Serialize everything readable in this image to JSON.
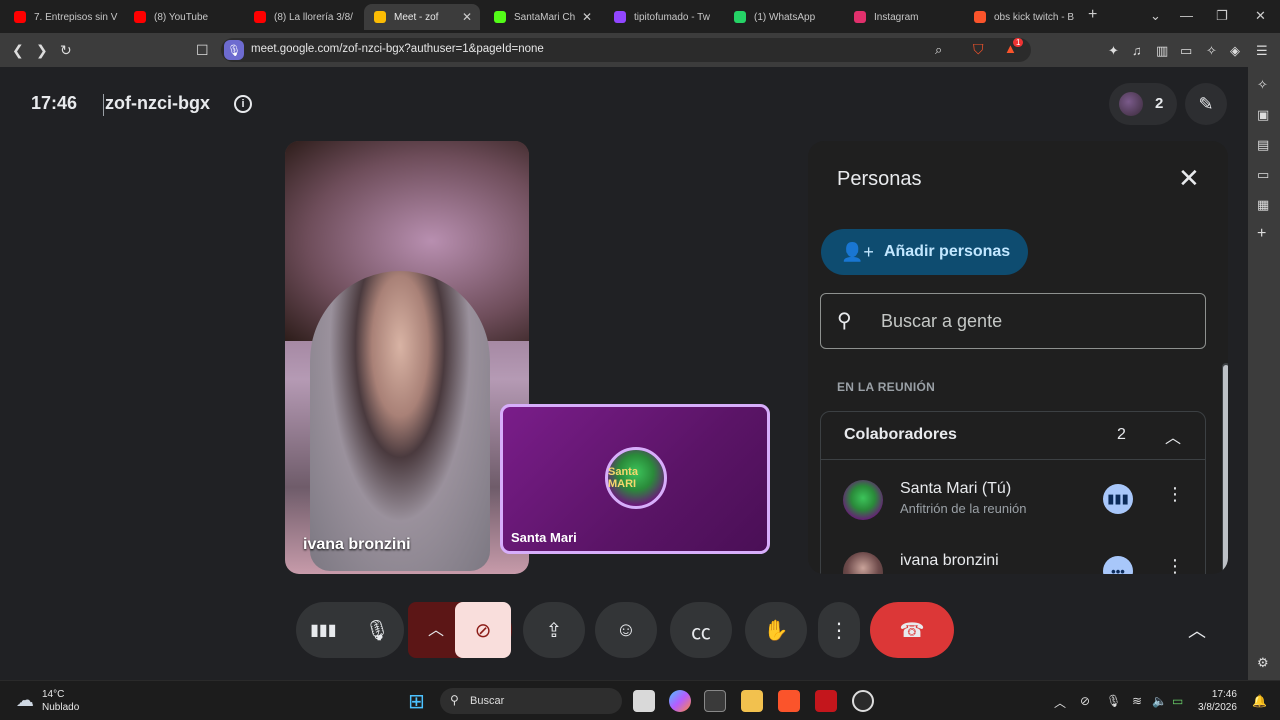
{
  "browser": {
    "tabs": [
      {
        "title": "7. Entrepisos sin V",
        "color": "#ff0000"
      },
      {
        "title": "(8) YouTube",
        "color": "#ff0000"
      },
      {
        "title": "(8) La llorería 3/8/",
        "color": "#ff0000"
      },
      {
        "title": "Meet - zof",
        "color": "#fbbc04",
        "active": true
      },
      {
        "title": "SantaMari Ch",
        "color": "#53fc18"
      },
      {
        "title": "tipitofumado - Tw",
        "color": "#9146ff"
      },
      {
        "title": "(1) WhatsApp",
        "color": "#25d366"
      },
      {
        "title": "Instagram",
        "color": "#e1306c"
      },
      {
        "title": "obs kick twitch - B",
        "color": "#fb542b"
      }
    ],
    "url": "meet.google.com/zof-nzci-bgx?authuser=1&pageId=none",
    "shield_badge": "1"
  },
  "meet": {
    "clock": "17:46",
    "meeting_code": "zof-nzci-bgx",
    "participant_count": "2",
    "tiles": {
      "main_name": "ivana bronzini",
      "self_name": "Santa Mari",
      "self_logo_text": "Santa MARI"
    },
    "panel": {
      "title": "Personas",
      "add_label": "Añadir personas",
      "search_placeholder": "Buscar a gente",
      "section_label": "EN LA REUNIÓN",
      "group_label": "Colaboradores",
      "group_count": "2",
      "people": [
        {
          "name": "Santa Mari (Tú)",
          "role": "Anfitrión de la reunión"
        },
        {
          "name": "ivana bronzini",
          "role": ""
        }
      ]
    }
  },
  "taskbar": {
    "temp": "14°C",
    "weather": "Nublado",
    "search_placeholder": "Buscar",
    "time": "17:46",
    "date": "3/8/2026"
  }
}
